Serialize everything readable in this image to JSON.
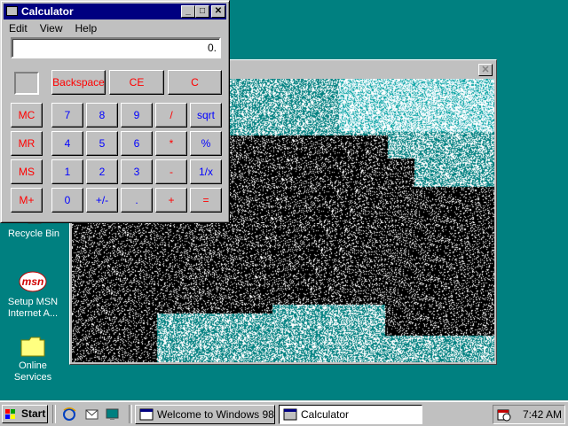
{
  "desktop": {
    "icons": [
      {
        "label_lines": [
          "Recycle Bin"
        ],
        "icon": "recycle-bin-icon"
      },
      {
        "label_lines": [
          "Setup MSN",
          "Internet A..."
        ],
        "icon": "msn-icon",
        "icon_text": "msn"
      },
      {
        "label_lines": [
          "Online",
          "Services"
        ],
        "icon": "folder-icon"
      }
    ]
  },
  "noise_window": {
    "close_glyph": "✕"
  },
  "calculator": {
    "title": "Calculator",
    "menu": [
      "Edit",
      "View",
      "Help"
    ],
    "display": "0.",
    "title_buttons": {
      "minimize": "_",
      "maximize": "□",
      "close": "✕"
    },
    "top_row": [
      "Backspace",
      "CE",
      "C"
    ],
    "memory": [
      "MC",
      "MR",
      "MS",
      "M+"
    ],
    "keys": [
      [
        "7",
        "8",
        "9",
        "/",
        "sqrt"
      ],
      [
        "4",
        "5",
        "6",
        "*",
        "%"
      ],
      [
        "1",
        "2",
        "3",
        "-",
        "1/x"
      ],
      [
        "0",
        "+/-",
        ".",
        "+",
        "="
      ]
    ]
  },
  "taskbar": {
    "start_label": "Start",
    "quick_launch": [
      "internet-explorer-icon",
      "outlook-express-icon",
      "show-desktop-icon"
    ],
    "tasks": [
      {
        "label": "Welcome to Windows 98",
        "icon": "window-icon",
        "active": false
      },
      {
        "label": "Calculator",
        "icon": "calculator-icon",
        "active": true
      }
    ],
    "clock": "7:42 AM",
    "tray_icon": "scheduler-icon"
  },
  "colors": {
    "desktop": "#008080",
    "title_active": "#000080",
    "key_red": "#ff0000",
    "key_blue": "#0000ff"
  }
}
